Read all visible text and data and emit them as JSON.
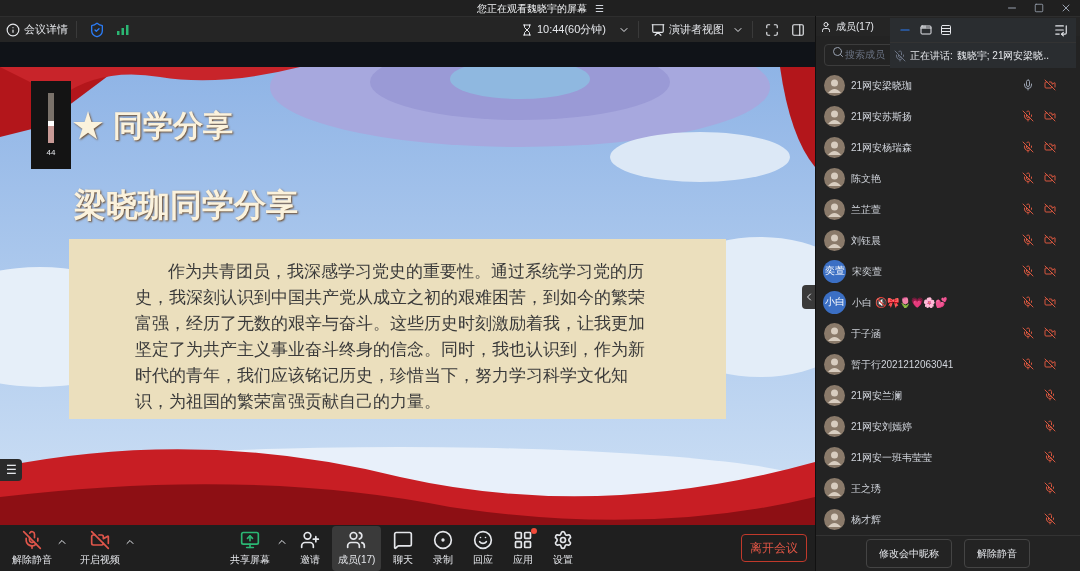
{
  "window": {
    "title": "您正在观看魏晓宇的屏幕",
    "view_menu_icon": "☰"
  },
  "toolbar": {
    "left": [
      {
        "kind": "info",
        "label": "会议详情"
      },
      {
        "kind": "shield"
      },
      {
        "kind": "signal"
      }
    ],
    "timer": "10:44(60分钟)",
    "view": "演讲者视图",
    "members_tab": "成员(17)"
  },
  "popover": {
    "speaking_label": "正在讲话:",
    "speaking": "魏晓宇; 21网安梁晓.."
  },
  "slide": {
    "heading": "★ 同学分享",
    "subheading": "梁晓珈同学分享",
    "paragraph": "作为共青团员，我深感学习党史的重要性。通过系统学习党的历史，我深刻认识到中国共产党从成立之初的艰难困苦，到如今的繁荣富强，经历了无数的艰辛与奋斗。这些历史时刻激励着我，让我更加坚定了为共产主义事业奋斗终身的信念。同时，我也认识到，作为新时代的青年，我们应该铭记历史，珍惜当下，努力学习科学文化知识，为祖国的繁荣富强贡献自己的力量。"
  },
  "volume_meter": {
    "level": 0.44,
    "reading": "44"
  },
  "side_handle": "☰",
  "members": {
    "search": {
      "placeholder": "搜索成员"
    },
    "list": [
      {
        "name": "21网安梁晓珈",
        "muted": false,
        "video": true
      },
      {
        "name": "21网安苏斯扬",
        "muted": true,
        "video": true
      },
      {
        "name": "21网安杨瑞森",
        "muted": true,
        "video": true
      },
      {
        "name": "陈文艳",
        "muted": true,
        "video": true
      },
      {
        "name": "兰芷萱",
        "muted": true,
        "video": true
      },
      {
        "name": "刘钰晨",
        "muted": true,
        "video": true
      },
      {
        "name": "宋奕萱",
        "avatar_text": "奕萱",
        "muted": true,
        "video": true
      },
      {
        "name": "小白 🔇🎀🌷💗🌸💕",
        "avatar_text": "小白",
        "muted": true,
        "video": true
      },
      {
        "name": "于子涵",
        "muted": true,
        "video": true
      },
      {
        "name": "暂于行2021212063041",
        "muted": true,
        "video": true
      },
      {
        "name": "21网安兰澜",
        "muted": true,
        "video": false
      },
      {
        "name": "21网安刘嫣婷",
        "muted": true,
        "video": false
      },
      {
        "name": "21网安一班韦莹莹",
        "muted": true,
        "video": false
      },
      {
        "name": "王之琇",
        "muted": true,
        "video": false
      },
      {
        "name": "杨才辉",
        "muted": true,
        "video": false
      }
    ],
    "buttons": [
      "修改会中昵称",
      "解除静音"
    ]
  },
  "bottom_bar": {
    "left": [
      {
        "kind": "mic",
        "label": "解除静音"
      },
      {
        "kind": "video",
        "label": "开启视频"
      }
    ],
    "center": [
      {
        "kind": "share",
        "label": "共享屏幕",
        "selected": false
      },
      {
        "kind": "invite",
        "label": "邀请",
        "selected": false
      },
      {
        "kind": "members",
        "label": "成员(17)",
        "selected": true
      },
      {
        "kind": "chat",
        "label": "聊天",
        "selected": false
      },
      {
        "kind": "record",
        "label": "录制",
        "selected": false
      },
      {
        "kind": "react",
        "label": "回应",
        "selected": false
      },
      {
        "kind": "apps",
        "label": "应用",
        "selected": false,
        "badge": true
      },
      {
        "kind": "settings",
        "label": "设置",
        "selected": false
      }
    ],
    "leave": "离开会议"
  }
}
